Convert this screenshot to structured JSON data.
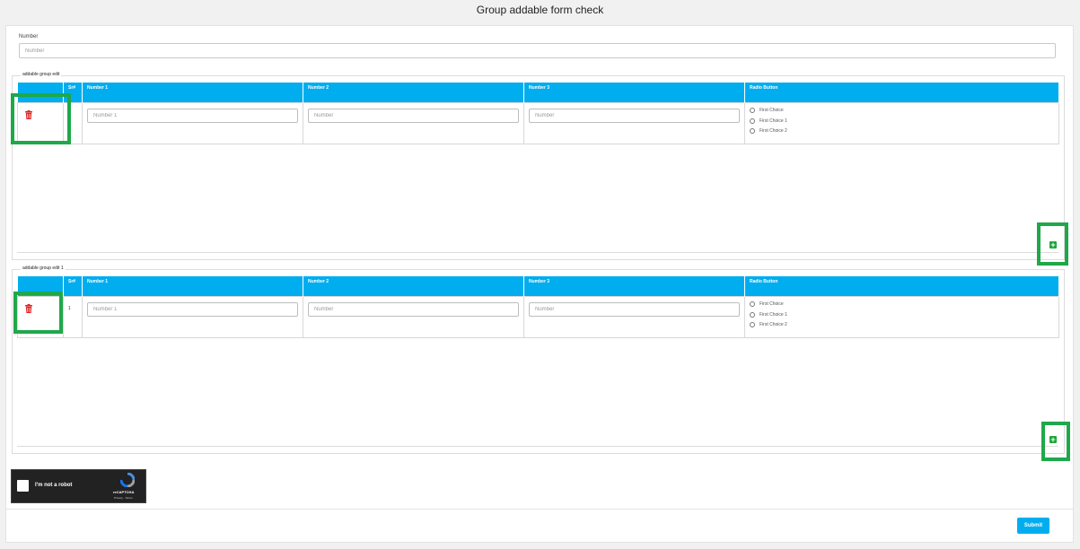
{
  "page": {
    "title": "Group addable form check"
  },
  "number_field": {
    "label": "Number",
    "placeholder": "Number"
  },
  "groups": [
    {
      "legend": "addable group edit",
      "columns": [
        "",
        "Sr#",
        "Number 1",
        "Number 2",
        "Number 3",
        "Radio Button"
      ],
      "row": {
        "sr": "",
        "number1_placeholder": "Number 1",
        "number2_placeholder": "Number",
        "number3_placeholder": "Number",
        "radio_options": [
          "First Choice",
          "First Choice 1",
          "First Choice 2"
        ]
      }
    },
    {
      "legend": "addable group edit 1",
      "columns": [
        "",
        "Sr#",
        "Number 1",
        "Number 2",
        "Number 3",
        "Radio Button"
      ],
      "row": {
        "sr": "1",
        "number1_placeholder": "Number 1",
        "number2_placeholder": "Number",
        "number3_placeholder": "Number",
        "radio_options": [
          "First Choice",
          "First Choice 1",
          "First Choice 2"
        ]
      }
    }
  ],
  "icons": {
    "delete": "trash-icon",
    "add": "plus-square-icon",
    "recaptcha": "recaptcha-logo"
  },
  "recaptcha": {
    "label": "I'm not a robot",
    "brand": "reCAPTCHA",
    "links": "Privacy - Terms"
  },
  "submit": {
    "label": "Submit"
  },
  "colors": {
    "header": "#00adef",
    "delete": "#e02424",
    "add": "#1ea53a",
    "highlight": "#1fa84a",
    "submit": "#00adef"
  }
}
